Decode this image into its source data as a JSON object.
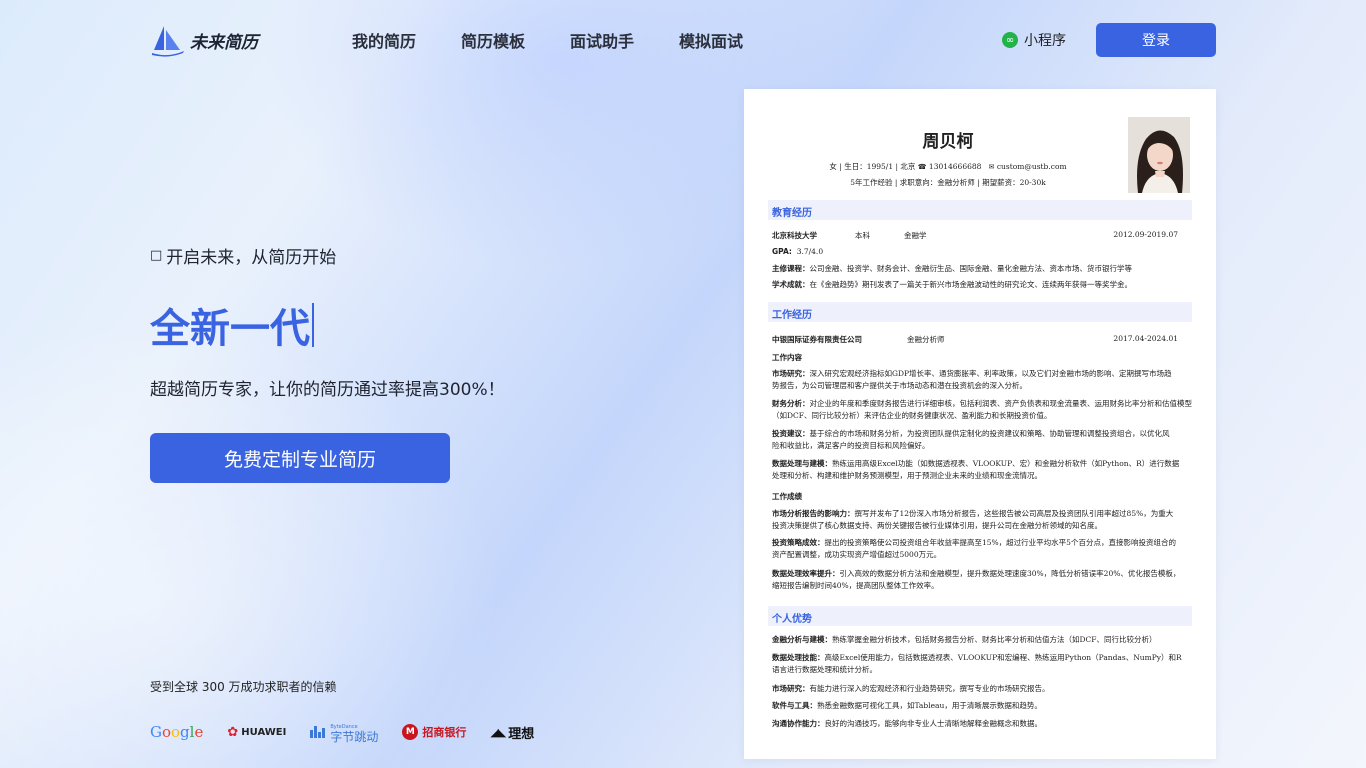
{
  "brand": {
    "name": "未来简历"
  },
  "nav": [
    "我的简历",
    "简历模板",
    "面试助手",
    "模拟面试"
  ],
  "mini_program": "小程序",
  "login": "登录",
  "hero": {
    "tagline": "开启未来，从简历开始",
    "headline": "全新一代",
    "subline": "超越简历专家，让你的简历通过率提高300%！",
    "cta": "免费定制专业简历"
  },
  "trust": "受到全球 300 万成功求职者的信赖",
  "brands": {
    "google": "Google",
    "huawei": "HUAWEI",
    "bytedance": "字节跳动",
    "bytedance_small": "ByteDance",
    "cmb": "招商银行",
    "lixiang": "理想"
  },
  "colors": {
    "accent": "#3a63e2",
    "section_bg": "#eef1fb"
  },
  "resume": {
    "name": "周贝柯",
    "basic": {
      "gender": "女",
      "birth": "生日：1995/1",
      "city": "北京",
      "phone": "13014666688",
      "email": "custom@ustb.com"
    },
    "intent": "5年工作经验 | 求职意向：金融分析师 | 期望薪资：20-30k",
    "education": {
      "title": "教育经历",
      "school": "北京科技大学",
      "degree": "本科",
      "major": "金融学",
      "period": "2012.09-2019.07",
      "gpa_label": "GPA:",
      "gpa": "3.7/4.0",
      "courses_label": "主修课程：",
      "courses": "公司金融、投资学、财务会计、金融衍生品、国际金融、量化金融方法、资本市场、货币银行学等",
      "achieve_label": "学术成就：",
      "achieve": "在《金融趋势》期刊发表了一篇关于新兴市场金融波动性的研究论文、连续两年获得一等奖学金。"
    },
    "work": {
      "title": "工作经历",
      "company": "中银国际证券有限责任公司",
      "role": "金融分析师",
      "period": "2017.04-2024.01",
      "content_title": "工作内容",
      "items": [
        {
          "label": "市场研究：",
          "l1": "深入研究宏观经济指标如GDP增长率、通货膨胀率、利率政策，以及它们对金融市场的影响、定期撰写市场趋",
          "l2": "势报告，为公司管理层和客户提供关于市场动态和潜在投资机会的深入分析。"
        },
        {
          "label": "财务分析：",
          "l1": "对企业的年度和季度财务报告进行详细审核，包括利润表、资产负债表和现金流量表、运用财务比率分析和估值模型",
          "l2": "（如DCF、同行比较分析）来评估企业的财务健康状况、盈利能力和长期投资价值。"
        },
        {
          "label": "投资建议：",
          "l1": "基于综合的市场和财务分析，为投资团队提供定制化的投资建议和策略、协助管理和调整投资组合，以优化风",
          "l2": "险和收益比，满足客户的投资目标和风险偏好。"
        },
        {
          "label": "数据处理与建模：",
          "l1": "熟练运用高级Excel功能（如数据透视表、VLOOKUP、宏）和金融分析软件（如Python、R）进行数据",
          "l2": "处理和分析、构建和维护财务预测模型，用于预测企业未来的业绩和现金流情况。"
        }
      ],
      "result_title": "工作成绩",
      "results": [
        {
          "label": "市场分析报告的影响力：",
          "l1": "撰写并发布了12份深入市场分析报告，这些报告被公司高层及投资团队引用率超过85%，为重大",
          "l2": "投资决策提供了核心数据支持、两份关键报告被行业媒体引用，提升公司在金融分析领域的知名度。"
        },
        {
          "label": "投资策略成效：",
          "l1": "提出的投资策略使公司投资组合年收益率提高至15%，超过行业平均水平5个百分点，直接影响投资组合的",
          "l2": "资产配置调整，成功实现资产增值超过5000万元。"
        },
        {
          "label": "数据处理效率提升：",
          "l1": "引入高效的数据分析方法和金融模型，提升数据处理速度30%，降低分析错误率20%、优化报告模板，",
          "l2": "缩短报告编制时间40%，提高团队整体工作效率。"
        }
      ]
    },
    "advantage": {
      "title": "个人优势",
      "items": [
        {
          "label": "金融分析与建模：",
          "l1": "熟练掌握金融分析技术，包括财务报告分析、财务比率分析和估值方法（如DCF、同行比较分析）",
          "l2": ""
        },
        {
          "label": "数据处理技能：",
          "l1": "高级Excel使用能力，包括数据透视表、VLOOKUP和宏编程、熟练运用Python（Pandas、NumPy）和R",
          "l2": "语言进行数据处理和统计分析。"
        },
        {
          "label": "市场研究：",
          "l1": "有能力进行深入的宏观经济和行业趋势研究，撰写专业的市场研究报告。",
          "l2": ""
        },
        {
          "label": "软件与工具：",
          "l1": "熟悉金融数据可视化工具，如Tableau，用于清晰展示数据和趋势。",
          "l2": ""
        },
        {
          "label": "沟通协作能力：",
          "l1": "良好的沟通技巧，能够向非专业人士清晰地解释金融概念和数据。",
          "l2": ""
        }
      ]
    }
  }
}
